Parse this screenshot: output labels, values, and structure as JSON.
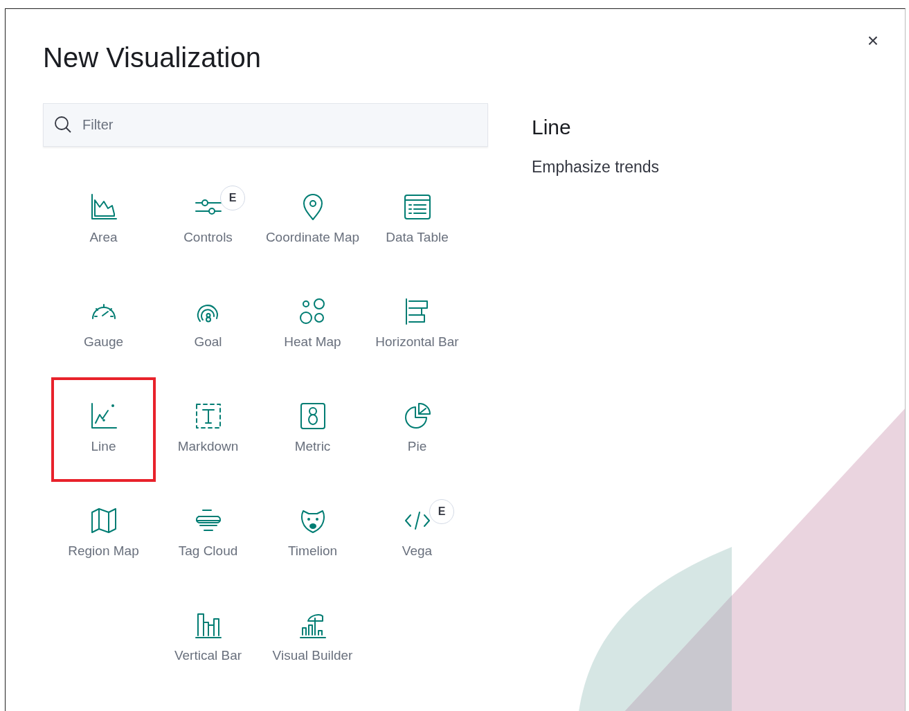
{
  "modal": {
    "title": "New Visualization",
    "close": "×"
  },
  "filter": {
    "placeholder": "Filter"
  },
  "types": [
    {
      "kind": "area",
      "label": "Area",
      "selected": false
    },
    {
      "kind": "controls",
      "label": "Controls",
      "selected": false,
      "badge": "E"
    },
    {
      "kind": "pin",
      "label": "Coordinate Map",
      "selected": false
    },
    {
      "kind": "table",
      "label": "Data Table",
      "selected": false
    },
    {
      "kind": "gauge",
      "label": "Gauge",
      "selected": false
    },
    {
      "kind": "goal",
      "label": "Goal",
      "selected": false
    },
    {
      "kind": "bubbles",
      "label": "Heat Map",
      "selected": false
    },
    {
      "kind": "hbar",
      "label": "Horizontal Bar",
      "selected": false
    },
    {
      "kind": "line",
      "label": "Line",
      "selected": true
    },
    {
      "kind": "markdown",
      "label": "Markdown",
      "selected": false
    },
    {
      "kind": "metric",
      "label": "Metric",
      "selected": false
    },
    {
      "kind": "pie",
      "label": "Pie",
      "selected": false
    },
    {
      "kind": "map",
      "label": "Region Map",
      "selected": false
    },
    {
      "kind": "cloud",
      "label": "Tag Cloud",
      "selected": false
    },
    {
      "kind": "bear",
      "label": "Timelion",
      "selected": false
    },
    {
      "kind": "code",
      "label": "Vega",
      "selected": false,
      "badge": "E"
    },
    {
      "kind": "vbar",
      "label": "Vertical Bar",
      "selected": false
    },
    {
      "kind": "builder",
      "label": "Visual Builder",
      "selected": false
    }
  ],
  "description": {
    "title": "Line",
    "text": "Emphasize trends"
  }
}
